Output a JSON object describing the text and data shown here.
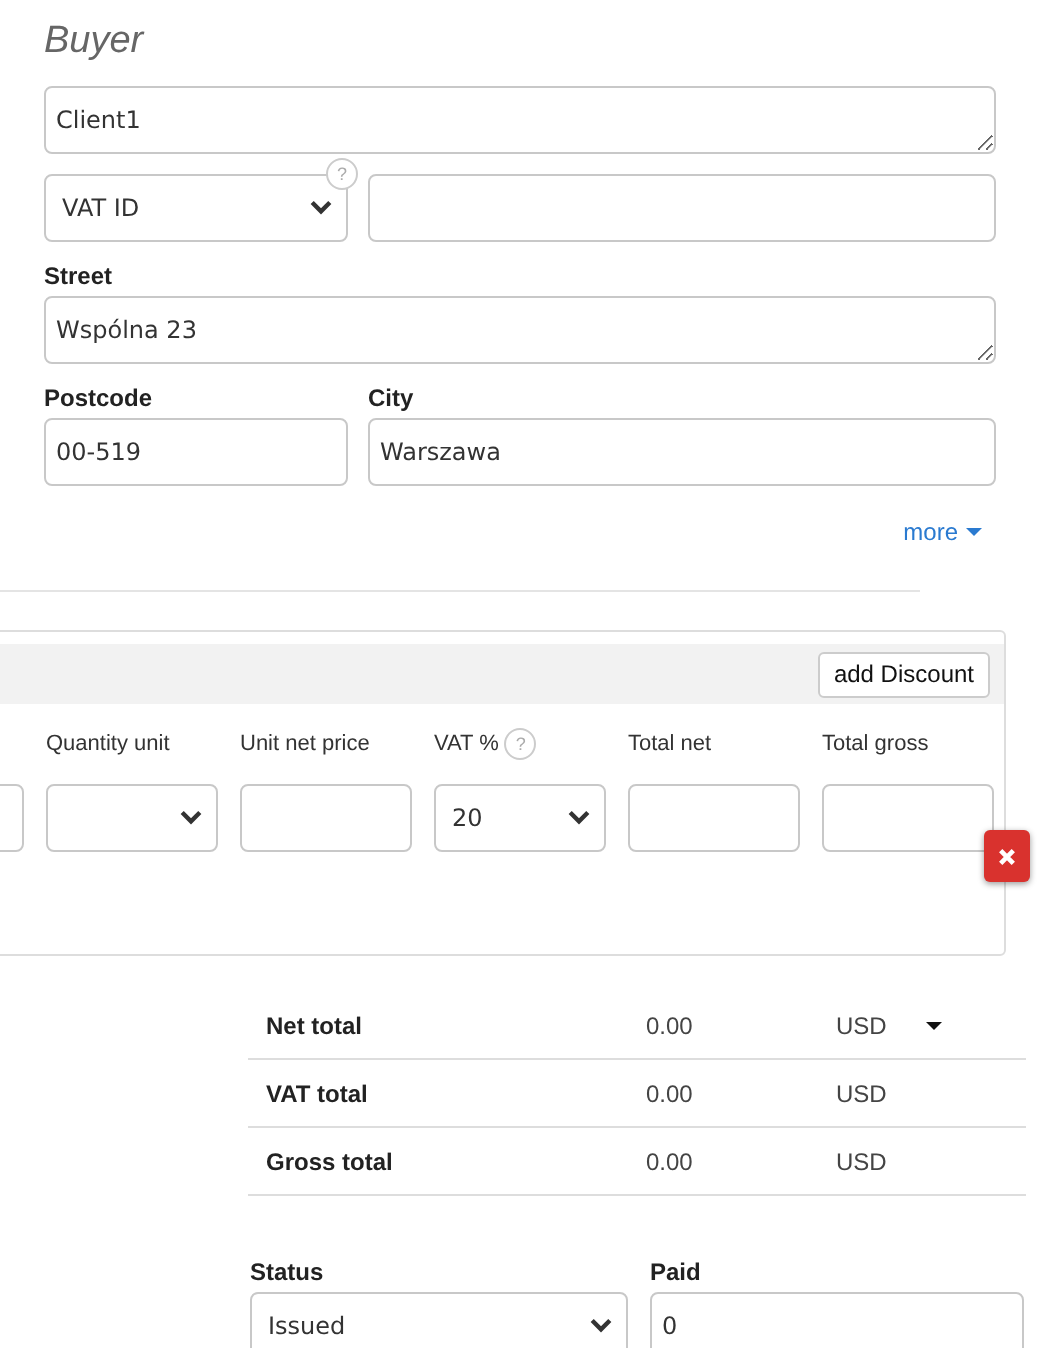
{
  "buyer": {
    "title": "Buyer",
    "name": "Client1",
    "tax_id_type": "VAT ID",
    "tax_id_help": "?",
    "street_label": "Street",
    "street": "Wspólna 23",
    "postcode_label": "Postcode",
    "postcode": "00-519",
    "city_label": "City",
    "city": "Warszawa",
    "more_link": "more"
  },
  "items": {
    "add_discount_button": "add Discount",
    "columns": [
      {
        "label": "Quantity unit",
        "kind": "select"
      },
      {
        "label": "Unit net price",
        "kind": "input"
      },
      {
        "label": "VAT %",
        "help": "?",
        "kind": "select",
        "value": "20"
      },
      {
        "label": "Total net",
        "kind": "input"
      },
      {
        "label": "Total gross",
        "kind": "input"
      }
    ]
  },
  "totals": [
    {
      "label": "Net total",
      "value": "0.00",
      "currency": "USD",
      "dropdown": true
    },
    {
      "label": "VAT total",
      "value": "0.00",
      "currency": "USD",
      "dropdown": false
    },
    {
      "label": "Gross total",
      "value": "0.00",
      "currency": "USD",
      "dropdown": false
    }
  ],
  "status": {
    "label": "Status",
    "value": "Issued"
  },
  "paid": {
    "label": "Paid",
    "value": "0"
  }
}
